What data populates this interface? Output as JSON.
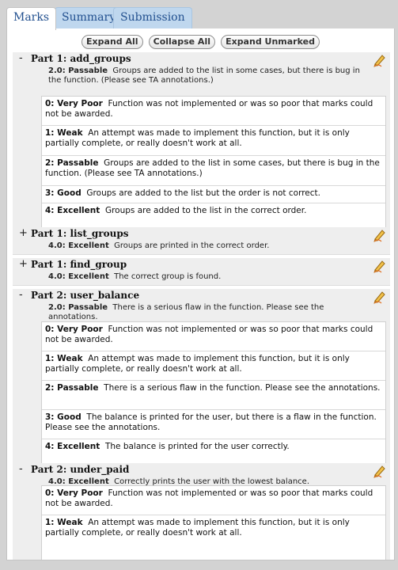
{
  "tabs": [
    {
      "label": "Marks"
    },
    {
      "label": "Summary"
    },
    {
      "label": "Submission Rule"
    }
  ],
  "buttons": {
    "expand_all": "Expand All",
    "collapse_all": "Collapse All",
    "expand_unmarked": "Expand Unmarked"
  },
  "criteria": [
    {
      "toggle": "-",
      "title": "Part 1: add_groups",
      "selected_level": "2.0: Passable",
      "selected_desc": "Groups are added to the list in some cases, but there is bug in the function. (Please see TA annotations.)",
      "levels": [
        {
          "name": "0: Very Poor",
          "desc": "Function was not implemented or was so poor that marks could not be awarded."
        },
        {
          "name": "1: Weak",
          "desc": "An attempt was made to implement this function, but it is only partially complete, or really doesn't work at all."
        },
        {
          "name": "2: Passable",
          "desc": "Groups are added to the list in some cases, but there is bug in the function. (Please see TA annotations.)"
        },
        {
          "name": "3: Good",
          "desc": "Groups are added to the list but the order is not correct."
        },
        {
          "name": "4: Excellent",
          "desc": "Groups are added to the list in the correct order."
        }
      ]
    },
    {
      "toggle": "+",
      "title": "Part 1: list_groups",
      "selected_level": "4.0: Excellent",
      "selected_desc": "Groups are printed in the correct order.",
      "levels": []
    },
    {
      "toggle": "+",
      "title": "Part 1: find_group",
      "selected_level": "4.0: Excellent",
      "selected_desc": "The correct group is found.",
      "levels": []
    },
    {
      "toggle": "-",
      "title": "Part 2: user_balance",
      "selected_level": "2.0: Passable",
      "selected_desc": "There is a serious flaw in the function. Please see the annotations.",
      "levels": [
        {
          "name": "0: Very Poor",
          "desc": "Function was not implemented or was so poor that marks could not be awarded."
        },
        {
          "name": "1: Weak",
          "desc": "An attempt was made to implement this function, but it is only partially complete, or really doesn't work at all."
        },
        {
          "name": "2: Passable",
          "desc": "There is a serious flaw in the function. Please see the annotations."
        },
        {
          "name": "3: Good",
          "desc": "The balance is printed for the user, but there is a flaw in the function. Please see the annotations."
        },
        {
          "name": "4: Excellent",
          "desc": "The balance is printed for the user correctly."
        }
      ]
    },
    {
      "toggle": "-",
      "title": "Part 2: under_paid",
      "selected_level": "4.0: Excellent",
      "selected_desc": "Correctly prints the user with the lowest balance.",
      "levels": [
        {
          "name": "0: Very Poor",
          "desc": "Function was not implemented or was so poor that marks could not be awarded."
        },
        {
          "name": "1: Weak",
          "desc": "An attempt was made to implement this function, but it is only partially complete, or really doesn't work at all."
        }
      ]
    }
  ],
  "colors": {
    "tab_text": "#22508f",
    "tab_inactive_bg": "#bfd7ee",
    "criterion_bg": "#eeeeee",
    "pencil": "#e0a020"
  },
  "icons": {
    "edit": "pencil-icon"
  }
}
